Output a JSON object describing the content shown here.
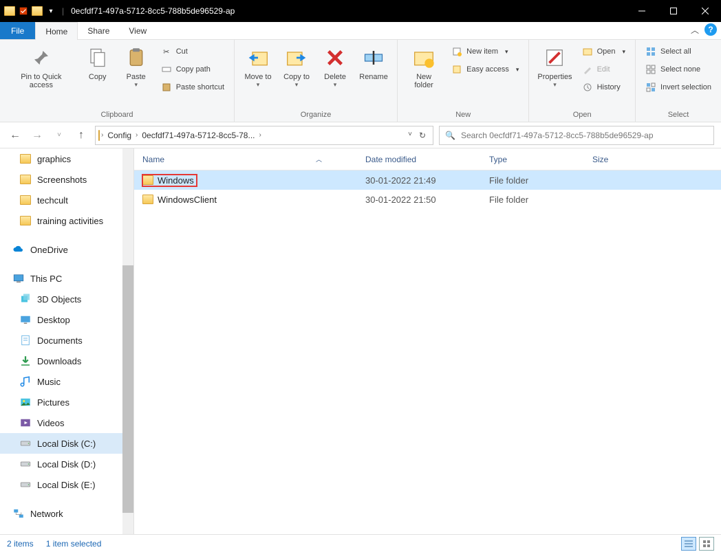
{
  "window": {
    "title": "0ecfdf71-497a-5712-8cc5-788b5de96529-ap"
  },
  "tabs": {
    "file": "File",
    "home": "Home",
    "share": "Share",
    "view": "View"
  },
  "ribbon": {
    "clipboard": {
      "label": "Clipboard",
      "pin": "Pin to Quick access",
      "copy": "Copy",
      "paste": "Paste",
      "cut": "Cut",
      "copypath": "Copy path",
      "pasteshortcut": "Paste shortcut"
    },
    "organize": {
      "label": "Organize",
      "moveto": "Move to",
      "copyto": "Copy to",
      "delete": "Delete",
      "rename": "Rename"
    },
    "new": {
      "label": "New",
      "newfolder": "New folder",
      "newitem": "New item",
      "easyaccess": "Easy access"
    },
    "open": {
      "label": "Open",
      "properties": "Properties",
      "open": "Open",
      "edit": "Edit",
      "history": "History"
    },
    "select": {
      "label": "Select",
      "selectall": "Select all",
      "selectnone": "Select none",
      "invert": "Invert selection"
    }
  },
  "breadcrumb": {
    "seg1": "Config",
    "seg2": "0ecfdf71-497a-5712-8cc5-78..."
  },
  "search": {
    "placeholder": "Search 0ecfdf71-497a-5712-8cc5-788b5de96529-ap"
  },
  "columns": {
    "name": "Name",
    "date": "Date modified",
    "type": "Type",
    "size": "Size"
  },
  "rows": [
    {
      "name": "Windows",
      "date": "30-01-2022 21:49",
      "type": "File folder",
      "size": "",
      "selected": true
    },
    {
      "name": "WindowsClient",
      "date": "30-01-2022 21:50",
      "type": "File folder",
      "size": "",
      "selected": false
    }
  ],
  "sidebar": {
    "quick": [
      {
        "label": "graphics",
        "icon": "folder"
      },
      {
        "label": "Screenshots",
        "icon": "folder"
      },
      {
        "label": "techcult",
        "icon": "folder"
      },
      {
        "label": "training activities",
        "icon": "folder"
      }
    ],
    "onedrive": "OneDrive",
    "thispc": "This PC",
    "pc": [
      {
        "label": "3D Objects",
        "icon": "3d"
      },
      {
        "label": "Desktop",
        "icon": "desktop"
      },
      {
        "label": "Documents",
        "icon": "documents"
      },
      {
        "label": "Downloads",
        "icon": "downloads"
      },
      {
        "label": "Music",
        "icon": "music"
      },
      {
        "label": "Pictures",
        "icon": "pictures"
      },
      {
        "label": "Videos",
        "icon": "videos"
      },
      {
        "label": "Local Disk (C:)",
        "icon": "disk",
        "selected": true
      },
      {
        "label": "Local Disk (D:)",
        "icon": "disk"
      },
      {
        "label": "Local Disk (E:)",
        "icon": "disk"
      }
    ],
    "network": "Network"
  },
  "status": {
    "count": "2 items",
    "selected": "1 item selected"
  }
}
